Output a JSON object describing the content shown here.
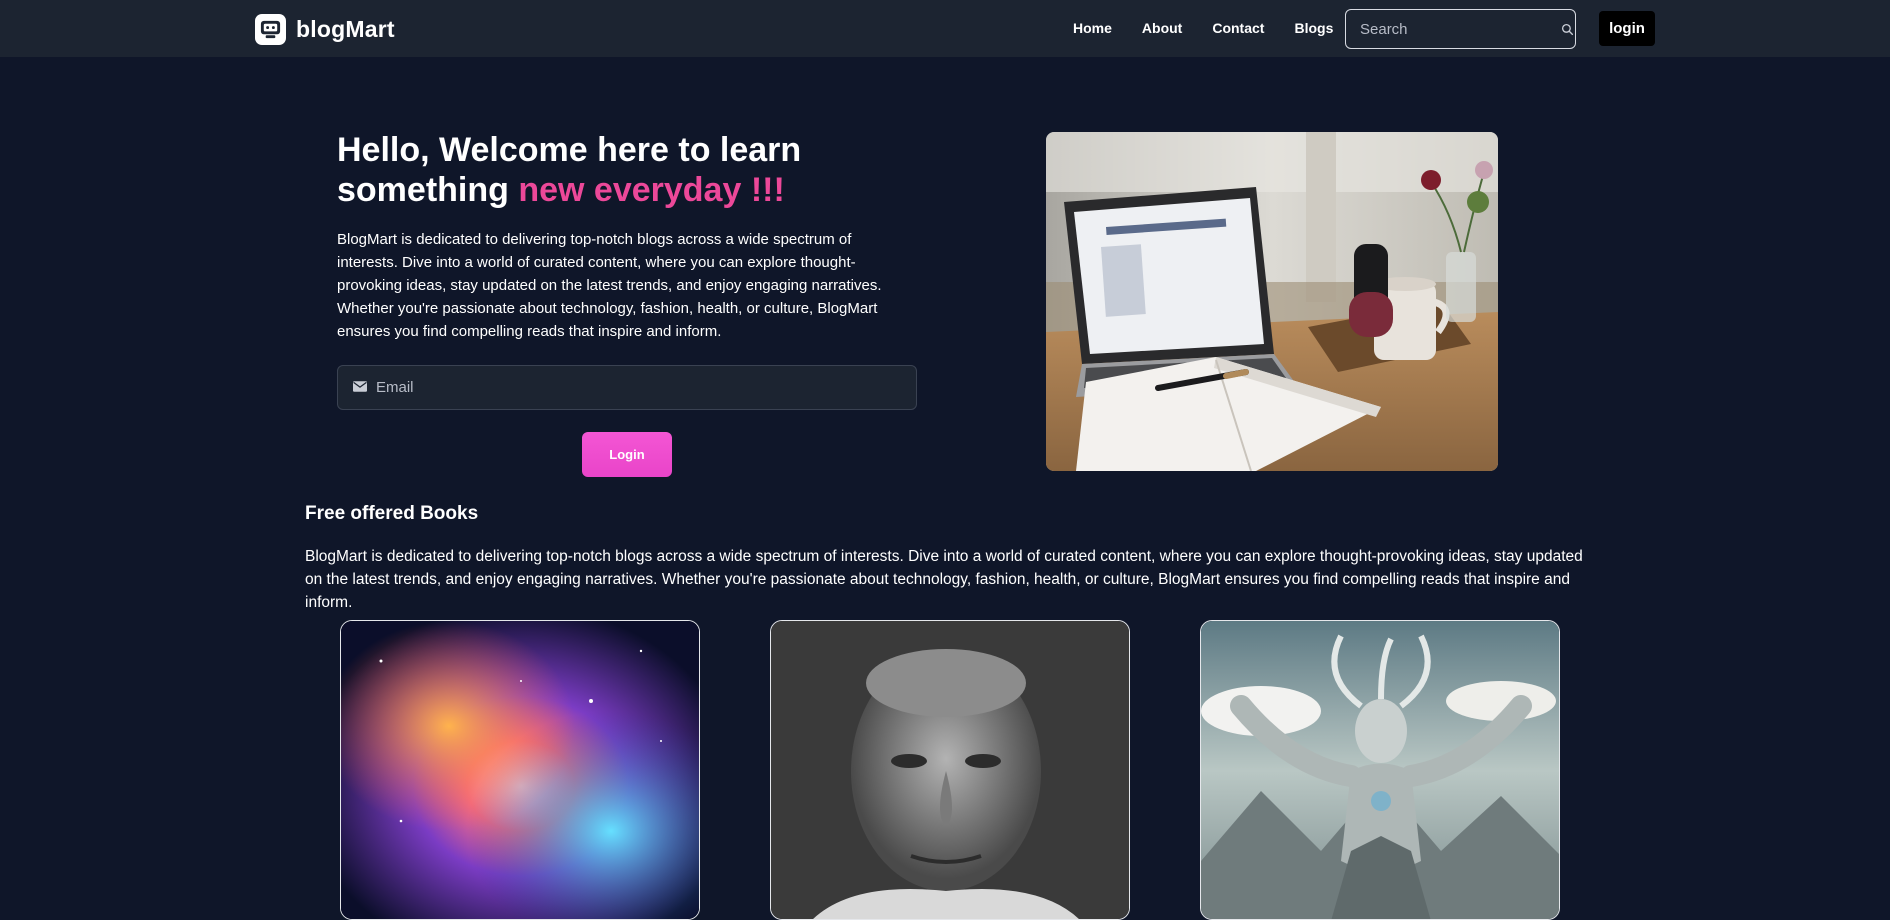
{
  "nav": {
    "brand": "blogMart",
    "links": [
      "Home",
      "About",
      "Contact",
      "Blogs"
    ],
    "search_placeholder": "Search",
    "login_label": "login"
  },
  "hero": {
    "title_main": "Hello, Welcome here to learn something ",
    "title_accent": "new everyday !!!",
    "description": "BlogMart is dedicated to delivering top-notch blogs across a wide spectrum of interests. Dive into a world of curated content, where you can explore thought-provoking ideas, stay updated on the latest trends, and enjoy engaging narratives. Whether you're passionate about technology, fashion, health, or culture, BlogMart ensures you find compelling reads that inspire and inform.",
    "email_placeholder": "Email",
    "login_button": "Login"
  },
  "books": {
    "title": "Free offered Books",
    "description": "BlogMart is dedicated to delivering top-notch blogs across a wide spectrum of interests. Dive into a world of curated content, where you can explore thought-provoking ideas, stay updated on the latest trends, and enjoy engaging narratives. Whether you're passionate about technology, fashion, health, or culture, BlogMart ensures you find compelling reads that inspire and inform."
  },
  "colors": {
    "background": "#0f1629",
    "navbar": "#1c2431",
    "accent": "#ec4899",
    "button": "#ec4fd0"
  },
  "icons": [
    "logo-icon",
    "search-icon",
    "envelope-icon"
  ]
}
